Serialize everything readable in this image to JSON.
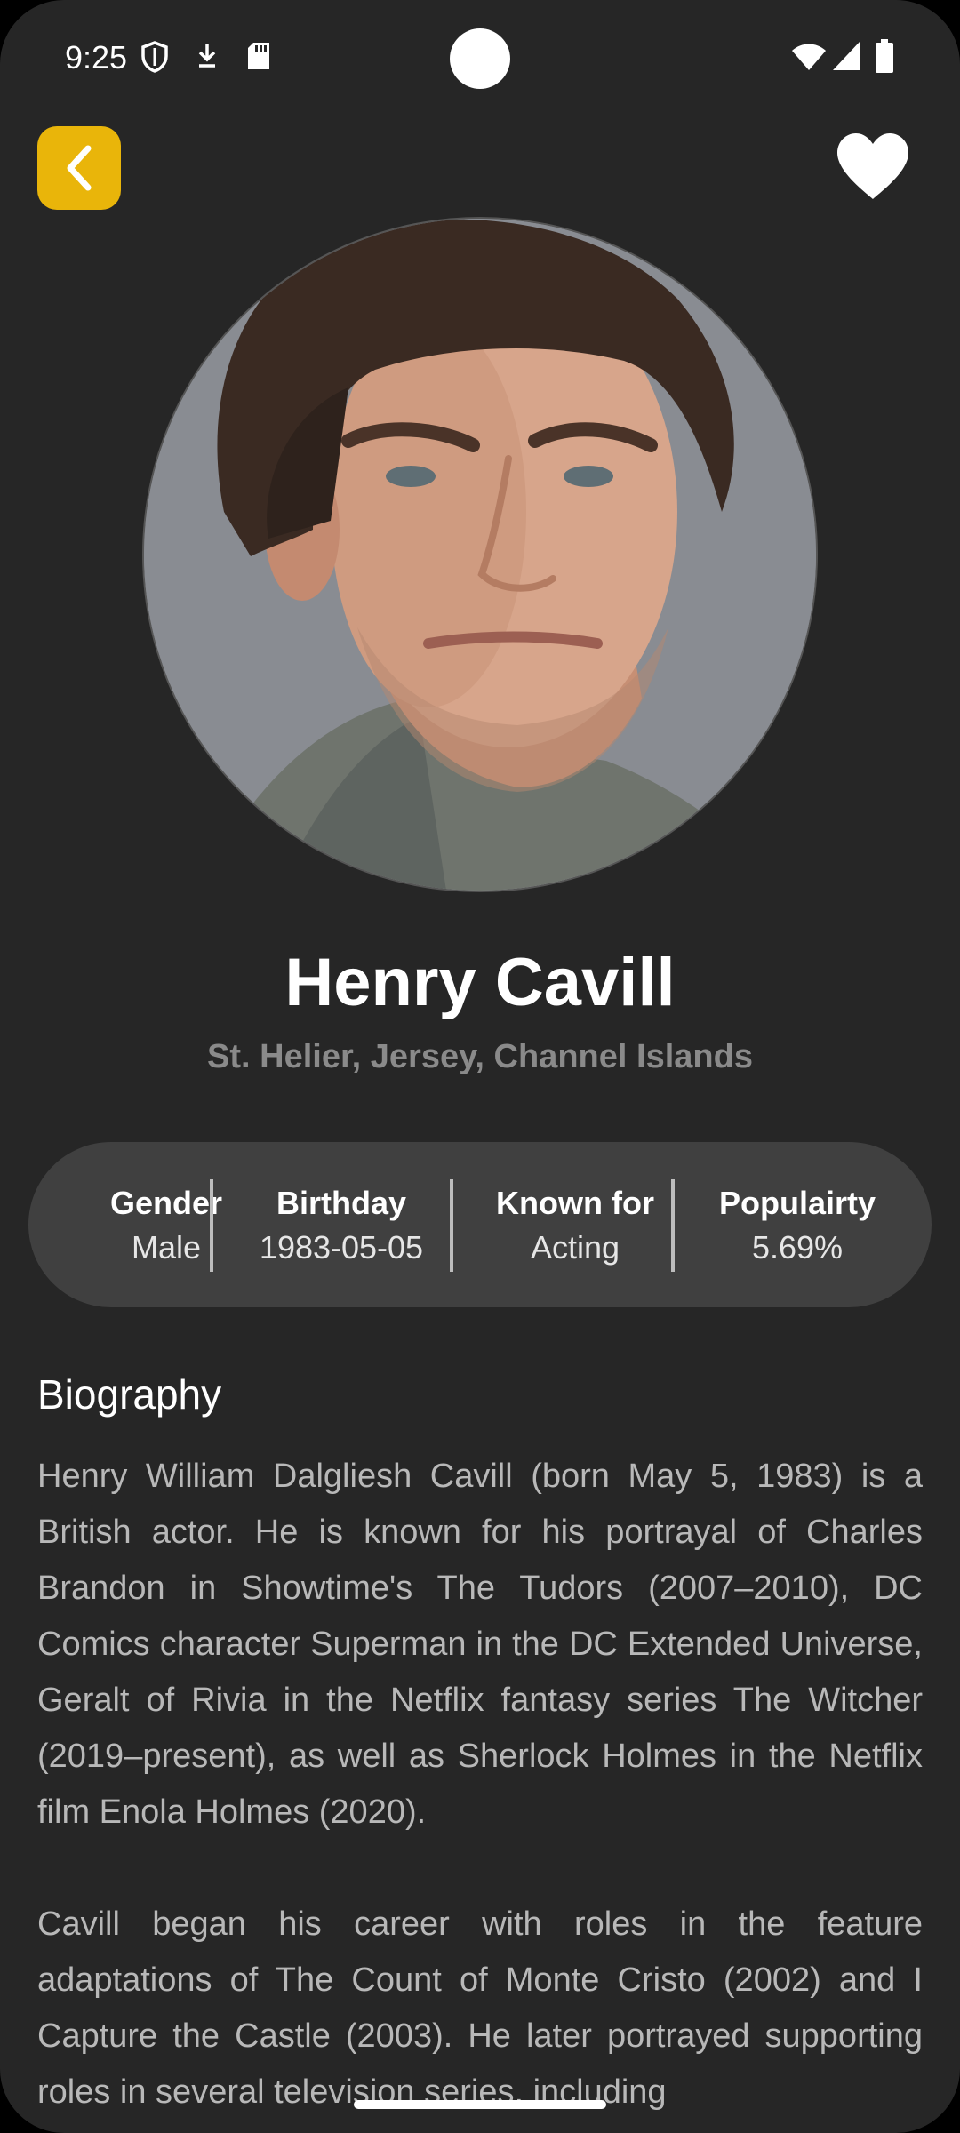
{
  "status_bar": {
    "time": "9:25",
    "icons": [
      "shield-icon",
      "download-icon",
      "sd-card-icon",
      "wifi-icon",
      "signal-icon",
      "battery-icon"
    ]
  },
  "header": {
    "back_icon": "chevron-left-icon",
    "favorite_icon": "heart-icon",
    "accent_color": "#e9b50a"
  },
  "person": {
    "name": "Henry Cavill",
    "birthplace": "St. Helier, Jersey, Channel Islands"
  },
  "info": [
    {
      "label": "Gender",
      "value": "Male"
    },
    {
      "label": "Birthday",
      "value": "1983-05-05"
    },
    {
      "label": "Known for",
      "value": "Acting"
    },
    {
      "label": "Populairty",
      "value": "5.69%"
    }
  ],
  "biography": {
    "heading": "Biography",
    "paragraphs": [
      "Henry William Dalgliesh Cavill (born May 5, 1983) is a British actor. He is known for his portrayal of Charles Brandon in Showtime's The Tudors (2007–2010), DC Comics character Superman in the DC Extended Universe, Geralt of Rivia in the Netflix fantasy series The Witcher (2019–present), as well as Sherlock Holmes in the Netflix film Enola Holmes (2020).",
      "Cavill began his career with roles in the feature adaptations of The Count of Monte Cristo (2002) and I Capture the Castle (2003). He later portrayed supporting roles in several television series, including"
    ]
  }
}
